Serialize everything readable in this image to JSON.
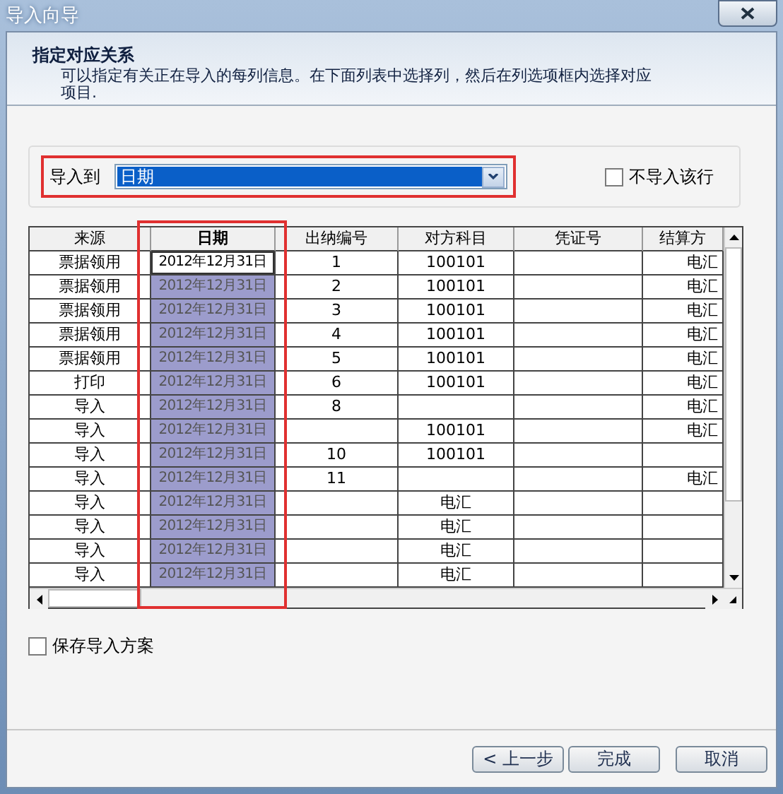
{
  "window": {
    "title": "导入向导"
  },
  "header": {
    "title": "指定对应关系",
    "description": "可以指定有关正在导入的每列信息。在下面列表中选择列，然后在列选项框内选择对应项目."
  },
  "mapping": {
    "label": "导入到",
    "value": "日期",
    "highlighted": true,
    "skip_row": {
      "label": "不导入该行",
      "checked": false
    }
  },
  "table": {
    "columns": [
      {
        "label": "来源",
        "selected": false
      },
      {
        "label": "日期",
        "selected": true
      },
      {
        "label": "出纳编号",
        "selected": false
      },
      {
        "label": "对方科目",
        "selected": false
      },
      {
        "label": "凭证号",
        "selected": false
      },
      {
        "label": "结算方",
        "selected": false
      }
    ],
    "rows": [
      {
        "current": true,
        "cells": [
          "票据领用",
          "2012年12月31日",
          "1",
          "100101",
          null,
          "电汇"
        ]
      },
      {
        "current": false,
        "cells": [
          "票据领用",
          "2012年12月31日",
          "2",
          "100101",
          null,
          "电汇"
        ]
      },
      {
        "current": false,
        "cells": [
          "票据领用",
          "2012年12月31日",
          "3",
          "100101",
          null,
          "电汇"
        ]
      },
      {
        "current": false,
        "cells": [
          "票据领用",
          "2012年12月31日",
          "4",
          "100101",
          null,
          "电汇"
        ]
      },
      {
        "current": false,
        "cells": [
          "票据领用",
          "2012年12月31日",
          "5",
          "100101",
          null,
          "电汇"
        ]
      },
      {
        "current": false,
        "cells": [
          "打印",
          "2012年12月31日",
          "6",
          "100101",
          null,
          "电汇"
        ]
      },
      {
        "current": false,
        "cells": [
          "导入",
          "2012年12月31日",
          "8",
          null,
          null,
          "电汇"
        ]
      },
      {
        "current": false,
        "cells": [
          "导入",
          "2012年12月31日",
          null,
          "100101",
          null,
          "电汇"
        ]
      },
      {
        "current": false,
        "cells": [
          "导入",
          "2012年12月31日",
          "10",
          "100101",
          null,
          null
        ]
      },
      {
        "current": false,
        "cells": [
          "导入",
          "2012年12月31日",
          "11",
          null,
          null,
          "电汇"
        ]
      },
      {
        "current": false,
        "cells": [
          "导入",
          "2012年12月31日",
          null,
          "电汇",
          null,
          null
        ]
      },
      {
        "current": false,
        "cells": [
          "导入",
          "2012年12月31日",
          null,
          "电汇",
          null,
          null
        ]
      },
      {
        "current": false,
        "cells": [
          "导入",
          "2012年12月31日",
          null,
          "电汇",
          null,
          null
        ]
      },
      {
        "current": false,
        "cells": [
          "导入",
          "2012年12月31日",
          null,
          "电汇",
          null,
          null
        ]
      }
    ]
  },
  "save_scheme": {
    "label": "保存导入方案",
    "checked": false
  },
  "buttons": [
    "< 上一步",
    "完成",
    "取消"
  ]
}
